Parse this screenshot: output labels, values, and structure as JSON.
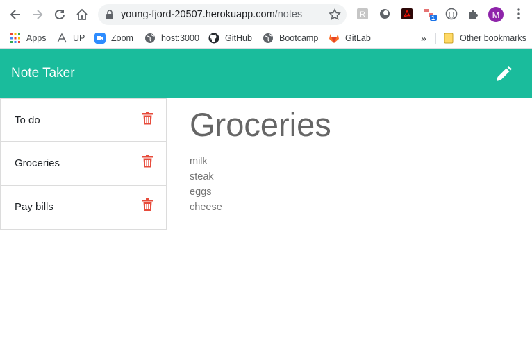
{
  "browser": {
    "url_host": "young-fjord-20507.herokuapp.com",
    "url_path": "/notes",
    "avatar_letter": "M",
    "extension_badge": "1"
  },
  "bookmarks": [
    {
      "label": "Apps",
      "icon": "apps-grid-icon"
    },
    {
      "label": "UP",
      "icon": "up-icon"
    },
    {
      "label": "Zoom",
      "icon": "zoom-icon"
    },
    {
      "label": "host:3000",
      "icon": "globe-icon"
    },
    {
      "label": "GitHub",
      "icon": "github-icon"
    },
    {
      "label": "Bootcamp",
      "icon": "globe-icon"
    },
    {
      "label": "GitLab",
      "icon": "gitlab-icon"
    }
  ],
  "bookmarks_overflow": "»",
  "other_bookmarks": "Other bookmarks",
  "app": {
    "brand": "Note Taker",
    "accent_color": "#1abc9c",
    "delete_color": "#e74c3c"
  },
  "notes": [
    {
      "title": "To do"
    },
    {
      "title": "Groceries"
    },
    {
      "title": "Pay bills"
    }
  ],
  "active_note": {
    "title": "Groceries",
    "body": [
      "milk",
      "steak",
      "eggs",
      "cheese"
    ]
  }
}
